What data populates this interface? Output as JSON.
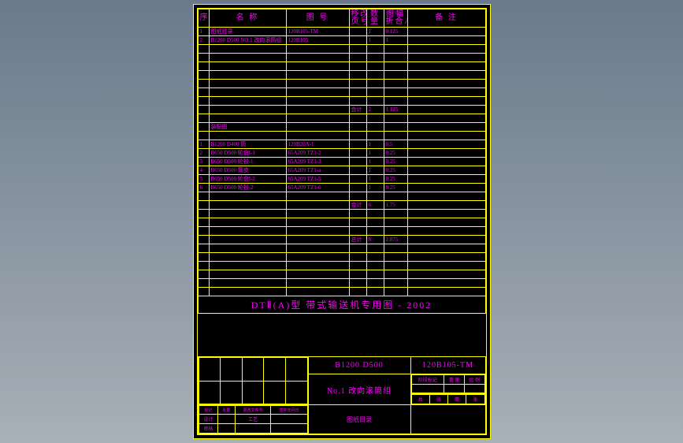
{
  "headers": {
    "seq": "序号",
    "name": "名   称",
    "drawing": "图    号",
    "col4a": "移改",
    "col4b": "页号",
    "col5a": "数",
    "col5b": "量",
    "col6a": "图幅",
    "col6b": "折合A1",
    "remark": "备  注"
  },
  "rows_top": [
    {
      "seq": "1",
      "name": "图纸目录",
      "dwg": "120B105-TM",
      "a": "",
      "b": "1",
      "c": "0.125",
      "rem": ""
    },
    {
      "seq": "2",
      "name": "B1200 D500 NO.1 改向滚筒组",
      "dwg": "120B105",
      "a": "",
      "b": "1",
      "c": "1",
      "rem": ""
    }
  ],
  "blank_top_count": 7,
  "subtotal1": {
    "label": "合计",
    "b": "2",
    "c": "1.125"
  },
  "gap_label_row": {
    "name": "装配图"
  },
  "rows_mid": [
    {
      "seq": "1",
      "name": "B1200 D400 筒",
      "dwg": "120B20A-1",
      "a": "",
      "b": "1",
      "c": "0.5",
      "rem": ""
    },
    {
      "seq": "2",
      "name": "B650 D500 轮盘I-1",
      "dwg": "65A209 TZ1-2",
      "a": "",
      "b": "1",
      "c": "0.25",
      "rem": ""
    },
    {
      "seq": "3",
      "name": "B650 D500 轮毂-1",
      "dwg": "65A209 TZ1-3",
      "a": "",
      "b": "1",
      "c": "0.25",
      "rem": ""
    },
    {
      "seq": "4",
      "name": "B650 D500 筒皮",
      "dwg": "65A209 TZ1-a",
      "a": "",
      "b": "1",
      "c": "0.25",
      "rem": ""
    },
    {
      "seq": "5",
      "name": "B650 D500 轮盘I-2",
      "dwg": "65A209 TZ1-5",
      "a": "",
      "b": "1",
      "c": "0.25",
      "rem": ""
    },
    {
      "seq": "6",
      "name": "B650 D500 轮毂-2",
      "dwg": "65A209 TZ1-6",
      "a": "",
      "b": "1",
      "c": "0.25",
      "rem": ""
    }
  ],
  "subtotal2": {
    "label": "合计",
    "b": "6",
    "c": "1.75"
  },
  "blank_mid_count": 3,
  "total": {
    "label": "总计",
    "b": "8",
    "c": "2.875"
  },
  "blank_bottom_count": 6,
  "title_main": "DTⅡ(A)型  带式输送机专用图 - 2002",
  "block": {
    "spec": "B1200  D500",
    "code": "120B105-TM",
    "name": "No.1 改向滚筒组",
    "foot_name": "图纸目录",
    "left_hdr": [
      "标记",
      "处数",
      "更改文件号",
      "签字年月日"
    ],
    "left_rows": [
      "设计",
      "",
      "工艺",
      ""
    ],
    "审核": "审核",
    "right_hdr": [
      "阶段标记",
      "重  量",
      "比  例"
    ],
    "共": "共",
    "张": "张",
    "第": "第"
  }
}
